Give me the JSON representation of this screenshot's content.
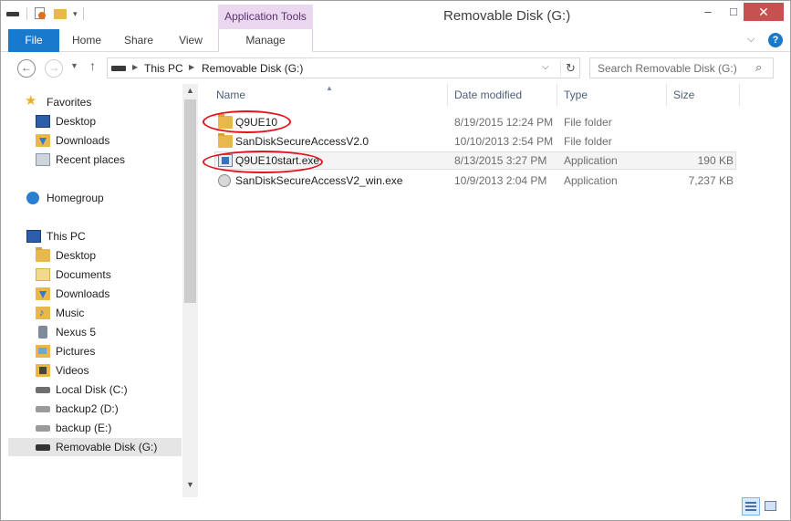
{
  "window": {
    "title": "Removable Disk (G:)",
    "controls": {
      "minimize": "–",
      "maximize": "□",
      "close": "✕"
    }
  },
  "ribbon": {
    "context_group": "Application Tools",
    "tabs": [
      "File",
      "Home",
      "Share",
      "View",
      "Manage"
    ],
    "help": "?"
  },
  "address": {
    "crumbs": [
      "This PC",
      "Removable Disk (G:)"
    ],
    "search_placeholder": "Search Removable Disk (G:)"
  },
  "nav": {
    "favorites": {
      "label": "Favorites",
      "items": [
        "Desktop",
        "Downloads",
        "Recent places"
      ]
    },
    "homegroup": "Homegroup",
    "this_pc": {
      "label": "This PC",
      "items": [
        "Desktop",
        "Documents",
        "Downloads",
        "Music",
        "Nexus 5",
        "Pictures",
        "Videos",
        "Local Disk (C:)",
        "backup2 (D:)",
        "backup (E:)",
        "Removable Disk (G:)"
      ]
    },
    "selected": "Removable Disk (G:)"
  },
  "columns": [
    "Name",
    "Date modified",
    "Type",
    "Size"
  ],
  "files": [
    {
      "name": "Q9UE10",
      "date": "8/19/2015 12:24 PM",
      "type": "File folder",
      "size": "",
      "icon": "folder-icon",
      "circled": true
    },
    {
      "name": "SanDiskSecureAccessV2.0",
      "date": "10/10/2013 2:54 PM",
      "type": "File folder",
      "size": "",
      "icon": "folder-icon",
      "circled": false
    },
    {
      "name": "Q9UE10start.exe",
      "date": "8/13/2015 3:27 PM",
      "type": "Application",
      "size": "190 KB",
      "icon": "application-icon",
      "circled": true,
      "hovered": true
    },
    {
      "name": "SanDiskSecureAccessV2_win.exe",
      "date": "10/9/2013 2:04 PM",
      "type": "Application",
      "size": "7,237 KB",
      "icon": "installer-disc-icon",
      "circled": false
    }
  ],
  "colors": {
    "file_tab": "#1979ca",
    "context_tab": "#ead7f0",
    "annotation_circle": "#e0141e"
  }
}
